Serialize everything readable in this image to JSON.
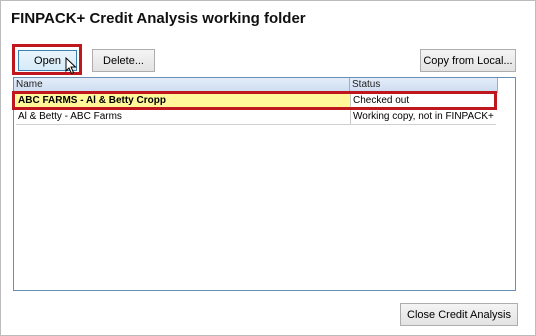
{
  "window": {
    "title": "FINPACK+ Credit Analysis working folder"
  },
  "toolbar": {
    "open_label": "Open",
    "delete_label": "Delete...",
    "copy_label": "Copy from Local..."
  },
  "list": {
    "columns": [
      "Name",
      "Status"
    ],
    "rows": [
      {
        "name": "ABC FARMS - Al & Betty Cropp",
        "status": "Checked out"
      },
      {
        "name": "Al & Betty - ABC Farms",
        "status": "Working copy, not in FINPACK+"
      }
    ]
  },
  "footer": {
    "close_label": "Close Credit Analysis"
  },
  "colors": {
    "highlight_red": "#c0161d",
    "selected_row_yellow": "#fff799"
  },
  "icons": {
    "cursor": "mouse-pointer-icon"
  }
}
